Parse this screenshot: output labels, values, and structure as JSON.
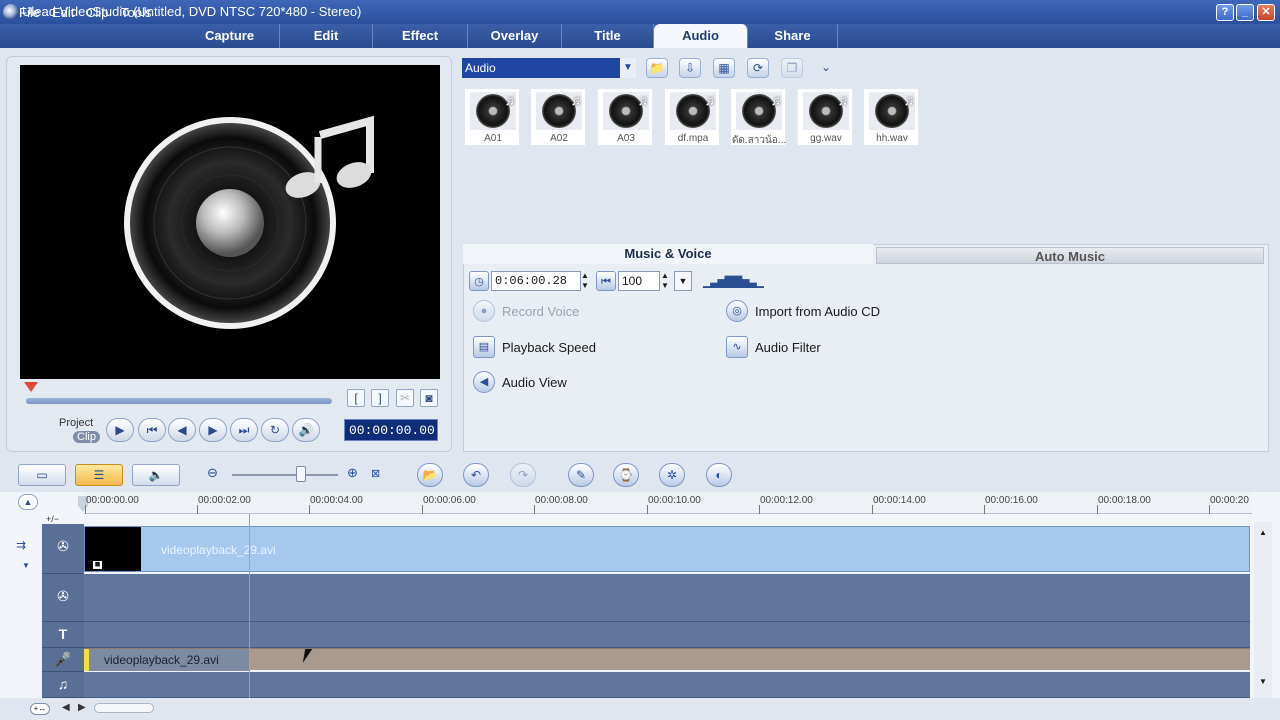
{
  "window": {
    "title": "Ulead VideoStudio (Untitled, DVD NTSC 720*480 - Stereo)",
    "help_label": "?",
    "minimize_label": "_",
    "maximize_label": "□",
    "close_label": "✕"
  },
  "menu": [
    "File",
    "Edit",
    "Clip",
    "Tools"
  ],
  "tabs": [
    "Capture",
    "Edit",
    "Effect",
    "Overlay",
    "Title",
    "Audio",
    "Share"
  ],
  "active_tab": "Audio",
  "preview": {
    "mode_project": "Project",
    "mode_clip": "Clip",
    "timecode": "00:00:00.00",
    "mark_in": "[",
    "mark_out": "]"
  },
  "library": {
    "category": "Audio",
    "items": [
      {
        "label": "A01"
      },
      {
        "label": "A02"
      },
      {
        "label": "A03"
      },
      {
        "label": "df.mpa"
      },
      {
        "label": "ดัด.สาวน้อ..."
      },
      {
        "label": "gg.wav"
      },
      {
        "label": "hh.wav"
      }
    ]
  },
  "music_voice": {
    "tab_music_voice": "Music & Voice",
    "tab_auto_music": "Auto Music",
    "duration": "0:06:00.28",
    "volume": "100",
    "actions": {
      "record_voice": "Record Voice",
      "import_cd": "Import from Audio CD",
      "playback_speed": "Playback Speed",
      "audio_filter": "Audio Filter",
      "audio_view": "Audio View"
    }
  },
  "timeline": {
    "ruler": [
      "00:00:00.00",
      "00:00:02.00",
      "00:00:04.00",
      "00:00:06.00",
      "00:00:08.00",
      "00:00:10.00",
      "00:00:12.00",
      "00:00:14.00",
      "00:00:16.00",
      "00:00:18.00",
      "00:00:20"
    ],
    "video_clip_name": "videoplayback_29.avi",
    "audio_clip_name": "videoplayback_29.avi",
    "track_toggle": "+/−"
  },
  "icons": {
    "video_track": "film-reel-icon",
    "overlay_track": "film-reel-icon",
    "title_track": "T-icon",
    "voice_track": "microphone-icon",
    "music_track": "note-icon"
  }
}
